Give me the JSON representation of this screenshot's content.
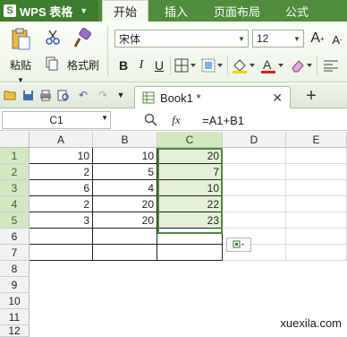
{
  "app": {
    "name": "WPS 表格",
    "logo_letter": "S"
  },
  "menu": {
    "tabs": [
      "开始",
      "插入",
      "页面布局",
      "公式"
    ],
    "active": 0
  },
  "ribbon": {
    "paste_label": "粘贴",
    "format_painter_label": "格式刷",
    "font_name": "宋体",
    "font_size": "12",
    "bold": "B",
    "italic": "I",
    "underline": "U"
  },
  "document": {
    "tab_title": "Book1 *"
  },
  "formula_bar": {
    "name_box": "C1",
    "fx_label": "fx",
    "formula": "=A1+B1"
  },
  "sheet": {
    "columns": [
      "A",
      "B",
      "C",
      "D",
      "E"
    ],
    "rows": [
      "1",
      "2",
      "3",
      "4",
      "5",
      "6",
      "7",
      "8",
      "9",
      "10",
      "11",
      "12"
    ],
    "data": [
      [
        "10",
        "10",
        "20"
      ],
      [
        "2",
        "5",
        "7"
      ],
      [
        "6",
        "4",
        "10"
      ],
      [
        "2",
        "20",
        "22"
      ],
      [
        "3",
        "20",
        "23"
      ]
    ],
    "selected_column": "C",
    "selected_rows": [
      "1",
      "2",
      "3",
      "4",
      "5"
    ]
  },
  "watermark": "xuexila.com"
}
